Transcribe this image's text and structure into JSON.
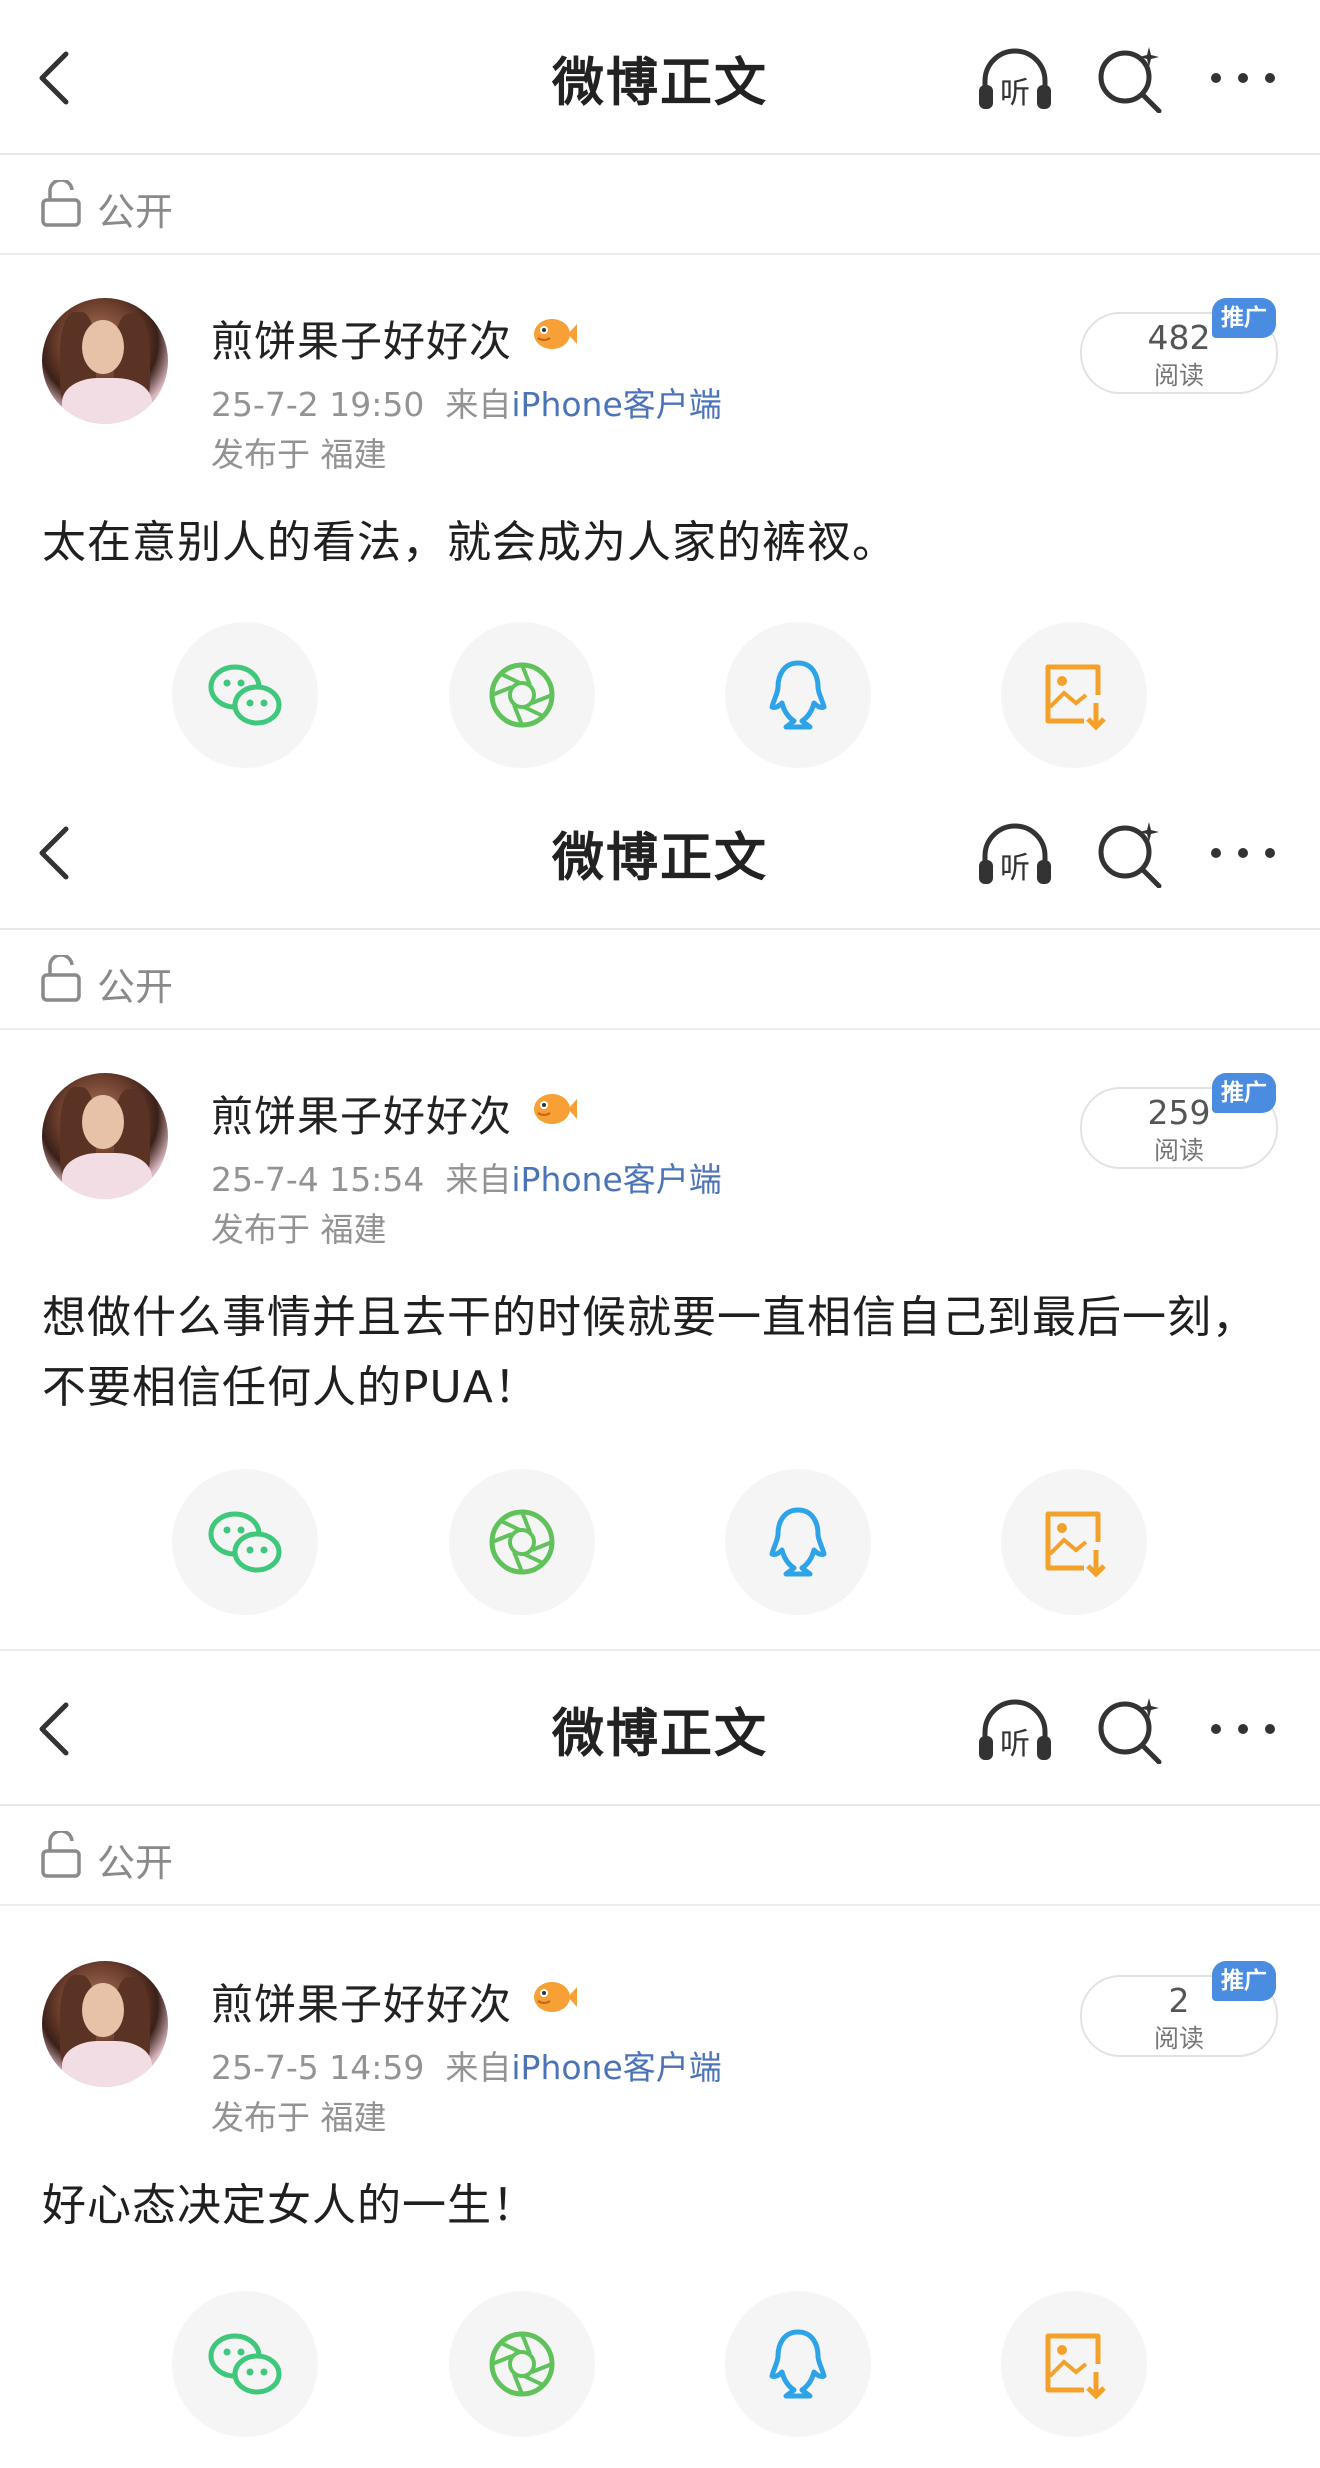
{
  "header": {
    "title": "微博正文"
  },
  "visibility": {
    "label": "公开"
  },
  "posts": [
    {
      "username": "煎饼果子好好次",
      "date": "25-7-2 19:50",
      "source_prefix": "来自",
      "source": "iPhone客户端",
      "location": "发布于 福建",
      "reads": "482",
      "reads_unit": "阅读",
      "promo": "推广",
      "text": "太在意别人的看法，就会成为人家的裤衩。"
    },
    {
      "username": "煎饼果子好好次",
      "date": "25-7-4 15:54",
      "source_prefix": "来自",
      "source": "iPhone客户端",
      "location": "发布于 福建",
      "reads": "259",
      "reads_unit": "阅读",
      "promo": "推广",
      "text": "想做什么事情并且去干的时候就要一直相信自己到最后一刻，不要相信任何人的PUA！"
    },
    {
      "username": "煎饼果子好好次",
      "date": "25-7-5 14:59",
      "source_prefix": "来自",
      "source": "iPhone客户端",
      "location": "发布于 福建",
      "reads": "2",
      "reads_unit": "阅读",
      "promo": "推广",
      "text": "好心态决定女人的一生！"
    }
  ],
  "share_icons": [
    "wechat-icon",
    "moments-icon",
    "qq-icon",
    "save-image-icon"
  ],
  "colors": {
    "wechat": "#3fc77b",
    "moments": "#5fc25b",
    "qq": "#2fa3e8",
    "save": "#f4a12a",
    "promo": "#4a8de0",
    "source_link": "#4b74b8"
  }
}
